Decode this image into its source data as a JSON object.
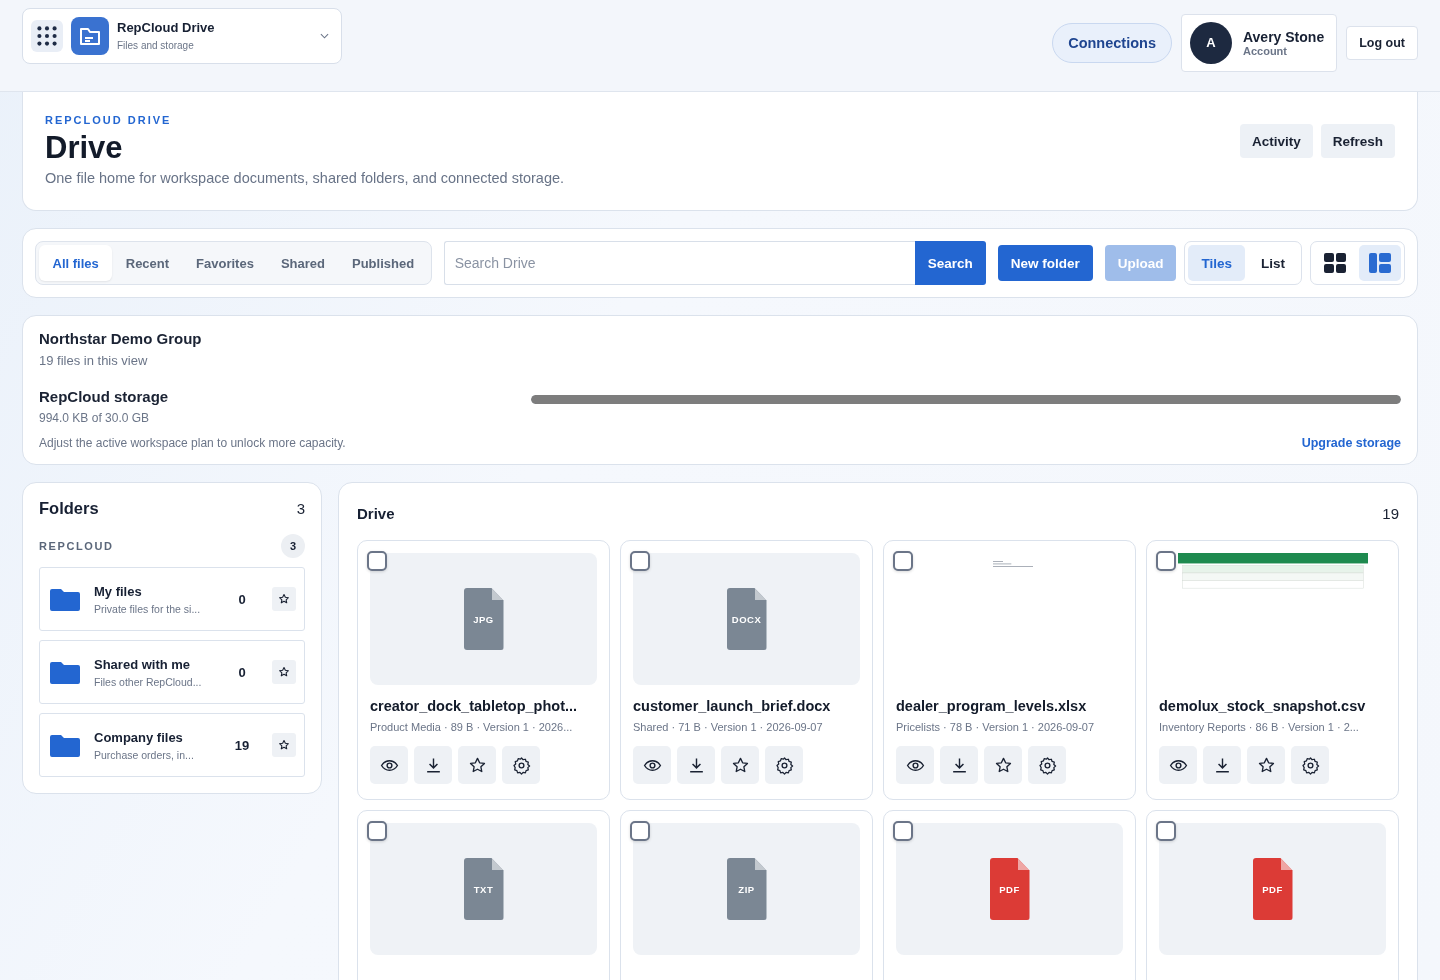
{
  "app_switcher": {
    "title": "RepCloud Drive",
    "subtitle": "Files and storage"
  },
  "top_actions": {
    "connections": "Connections",
    "user": {
      "initial": "A",
      "name": "Avery Stone",
      "role": "Account"
    },
    "logout": "Log out"
  },
  "header": {
    "eyebrow": "REPCLOUD DRIVE",
    "title": "Drive",
    "description": "One file home for workspace documents, shared folders, and connected storage.",
    "buttons": [
      "Activity",
      "Refresh"
    ]
  },
  "tabs": [
    {
      "label": "All files",
      "selected": true
    },
    {
      "label": "Recent",
      "selected": false
    },
    {
      "label": "Favorites",
      "selected": false
    },
    {
      "label": "Shared",
      "selected": false
    },
    {
      "label": "Published",
      "selected": false
    }
  ],
  "search": {
    "placeholder": "Search Drive",
    "button": "Search"
  },
  "actions": [
    {
      "label": "New folder",
      "disabled": false
    },
    {
      "label": "Upload",
      "disabled": true
    }
  ],
  "view_modes": [
    {
      "label": "Tiles",
      "selected": true
    },
    {
      "label": "List",
      "selected": false
    }
  ],
  "layouts": [
    {
      "kind": "grid",
      "selected": false
    },
    {
      "kind": "panel",
      "selected": true
    }
  ],
  "workspace": {
    "name": "Northstar Demo Group",
    "files": "19 files in this view",
    "storage_title": "RepCloud storage",
    "storage_used": "994.0 KB of 30.0 GB",
    "level": 1,
    "note": "Adjust the active workspace plan to unlock more capacity.",
    "upgrade": "Upgrade storage"
  },
  "folders": {
    "title": "Folders",
    "count": "3",
    "group": "REPCLOUD",
    "group_count": "3",
    "items": [
      {
        "name": "My files",
        "description": "Private files for the si...",
        "count": "0"
      },
      {
        "name": "Shared with me",
        "description": "Files other RepCloud...",
        "count": "0"
      },
      {
        "name": "Company files",
        "description": "Purchase orders, in...",
        "count": "19"
      }
    ]
  },
  "drive": {
    "title": "Drive",
    "count": "19",
    "files": [
      {
        "preview": {
          "kind": "icon",
          "label": "JPG",
          "color": "#7b8794"
        },
        "name": "creator_dock_tabletop_phot...",
        "meta": "Product Media · 89 B · Version 1 · 2026...",
        "checked": false
      },
      {
        "preview": {
          "kind": "icon",
          "label": "DOCX",
          "color": "#7b8794"
        },
        "name": "customer_launch_brief.docx",
        "meta": "Shared · 71 B · Version 1 · 2026-09-07",
        "checked": false
      },
      {
        "preview": {
          "kind": "document"
        },
        "name": "dealer_program_levels.xlsx",
        "meta": "Pricelists · 78 B · Version 1 · 2026-09-07",
        "checked": false
      },
      {
        "preview": {
          "kind": "sheet"
        },
        "name": "demolux_stock_snapshot.csv",
        "meta": "Inventory Reports · 86 B · Version 1 · 2...",
        "checked": false
      },
      {
        "preview": {
          "kind": "icon",
          "label": "TXT",
          "color": "#7b8794"
        },
        "checked": false
      },
      {
        "preview": {
          "kind": "icon",
          "label": "ZIP",
          "color": "#7b8794"
        },
        "checked": false
      },
      {
        "preview": {
          "kind": "icon",
          "label": "PDF",
          "color": "#dc3b36"
        },
        "checked": false
      },
      {
        "preview": {
          "kind": "icon",
          "label": "PDF",
          "color": "#dc3b36"
        },
        "checked": false
      }
    ]
  }
}
